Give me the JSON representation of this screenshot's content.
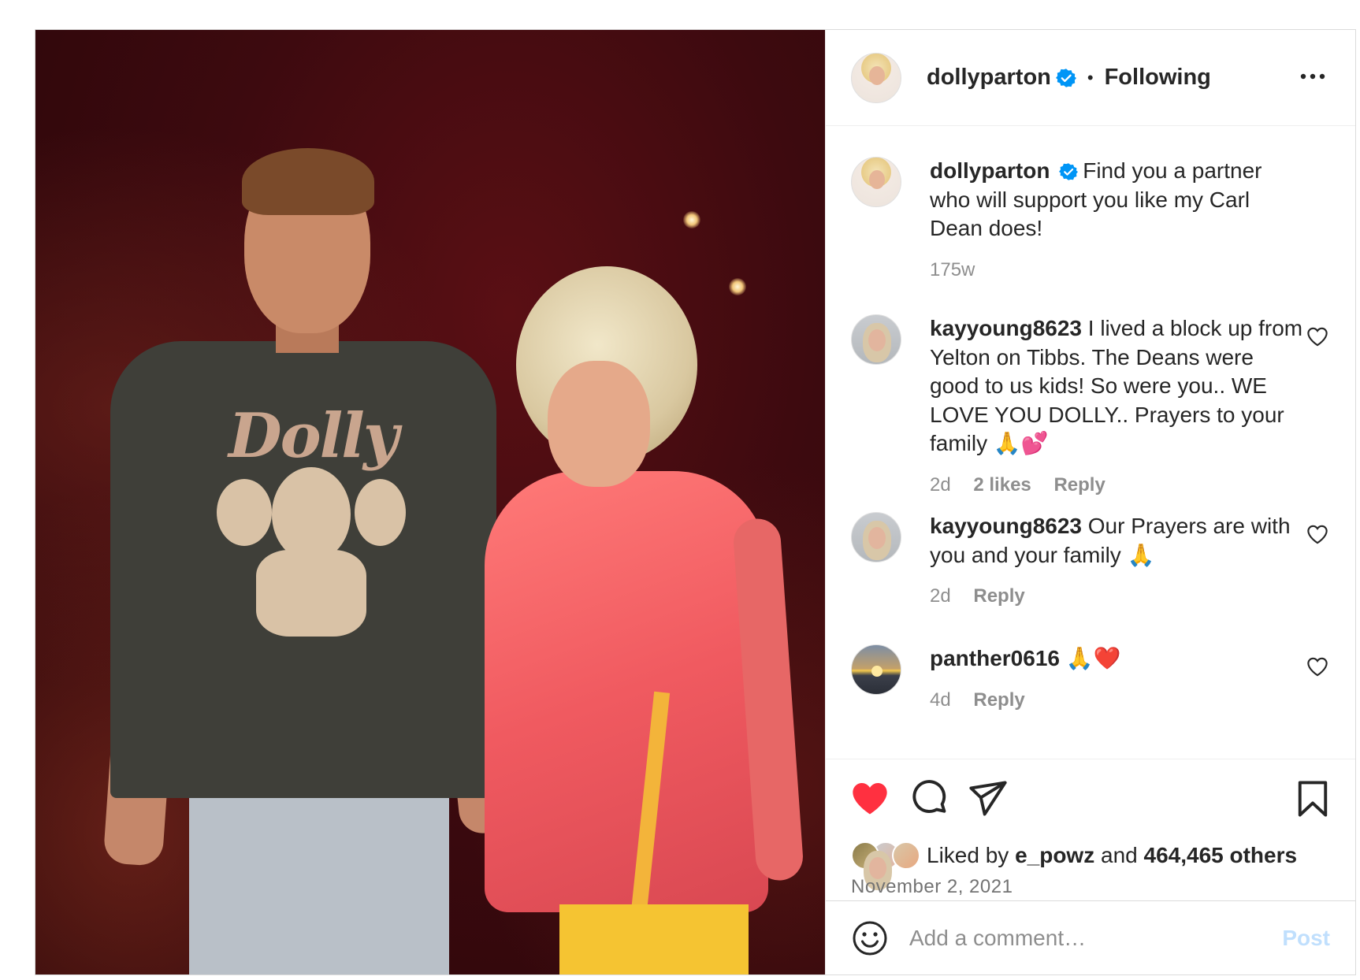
{
  "post": {
    "author": "dollyparton",
    "follow_status": "Following",
    "separator": "•",
    "caption": {
      "user": "dollyparton",
      "text": "Find you a partner who will support you like my Carl Dean does!",
      "age": "175w"
    },
    "photo": {
      "shirt_text": "Dolly"
    }
  },
  "comments": [
    {
      "user": "kayyoung8623",
      "text": "I lived a block up from Yelton on Tibbs. The Deans were good to us kids! So were you.. WE LOVE YOU DOLLY.. Prayers to your family 🙏💕",
      "age": "2d",
      "likes": "2 likes",
      "reply": "Reply"
    },
    {
      "user": "kayyoung8623",
      "text": "Our Prayers are with you and your family 🙏",
      "age": "2d",
      "reply": "Reply"
    },
    {
      "user": "panther0616",
      "text": "🙏❤️",
      "age": "4d",
      "reply": "Reply"
    }
  ],
  "engagement": {
    "liked_by_prefix": "Liked by",
    "liked_by_user": "e_powz",
    "and": "and",
    "others": "464,465 others",
    "date": "November 2, 2021"
  },
  "composer": {
    "placeholder": "Add a comment…",
    "post_label": "Post"
  },
  "colors": {
    "like_red": "#ff3040",
    "verified_blue": "#0095f6",
    "post_disabled": "#c0dffd",
    "secondary_text": "#8e8e8e"
  },
  "icons": [
    "more-icon",
    "verified-icon",
    "heart-filled-icon",
    "comment-icon",
    "share-icon",
    "bookmark-icon",
    "heart-outline-icon",
    "emoji-icon"
  ]
}
